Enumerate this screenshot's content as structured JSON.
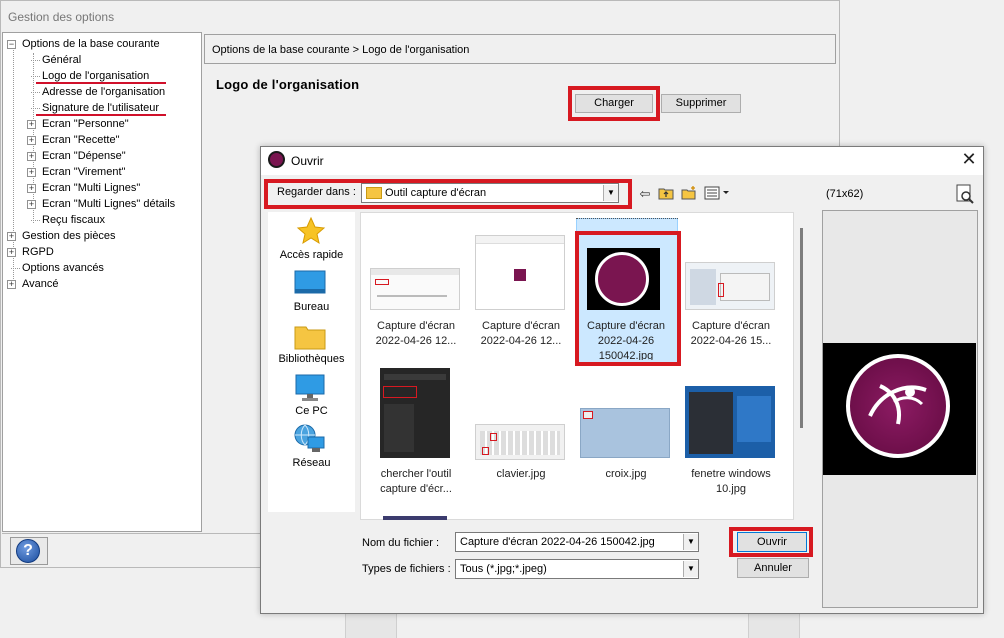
{
  "options_window": {
    "title": "Gestion des options",
    "breadcrumb": "Options de la base courante > Logo de l'organisation",
    "section_title": "Logo de l'organisation",
    "load_button": "Charger",
    "delete_button": "Supprimer",
    "help_icon": "?"
  },
  "tree": {
    "items": [
      {
        "label": "Options de la base courante",
        "expander": "−"
      },
      {
        "label": "Général"
      },
      {
        "label": "Logo de l'organisation"
      },
      {
        "label": "Adresse de l'organisation"
      },
      {
        "label": "Signature de l'utilisateur"
      },
      {
        "label": "Ecran \"Personne\"",
        "expander": "+"
      },
      {
        "label": "Ecran \"Recette\"",
        "expander": "+"
      },
      {
        "label": "Ecran \"Dépense\"",
        "expander": "+"
      },
      {
        "label": "Ecran \"Virement\"",
        "expander": "+"
      },
      {
        "label": "Ecran \"Multi Lignes\"",
        "expander": "+"
      },
      {
        "label": "Ecran \"Multi Lignes\" détails",
        "expander": "+"
      },
      {
        "label": "Reçu fiscaux"
      },
      {
        "label": "Gestion des pièces",
        "expander": "+"
      },
      {
        "label": "RGPD",
        "expander": "+"
      },
      {
        "label": "Options avancés"
      },
      {
        "label": "Avancé",
        "expander": "+"
      }
    ]
  },
  "dialog": {
    "title": "Ouvrir",
    "close": "✕",
    "look_in_label": "Regarder dans :",
    "look_in_value": "Outil capture d'écran",
    "preview_size": "(71x62)",
    "sidebar": [
      "Accès rapide",
      "Bureau",
      "Bibliothèques",
      "Ce PC",
      "Réseau"
    ],
    "files": [
      {
        "line1": "Capture d'écran",
        "line2": "2022-04-26 12..."
      },
      {
        "line1": "Capture d'écran",
        "line2": "2022-04-26 12..."
      },
      {
        "line1": "Capture d'écran",
        "line2": "2022-04-26",
        "line3": "150042.jpg"
      },
      {
        "line1": "Capture d'écran",
        "line2": "2022-04-26 15..."
      },
      {
        "line1": "chercher l'outil",
        "line2": "capture d'écr..."
      },
      {
        "line1": "clavier.jpg"
      },
      {
        "line1": "croix.jpg"
      },
      {
        "line1": "fenetre windows",
        "line2": "10.jpg"
      }
    ],
    "filename_label": "Nom du fichier :",
    "filename_value": "Capture d'écran 2022-04-26 150042.jpg",
    "filetype_label": "Types de fichiers :",
    "filetype_value": "Tous (*.jpg;*.jpeg)",
    "open_button": "Ouvrir",
    "cancel_button": "Annuler"
  },
  "colors": {
    "highlight": "#d71921",
    "logo_purple": "#7a1550",
    "selection": "#cce8ff"
  }
}
